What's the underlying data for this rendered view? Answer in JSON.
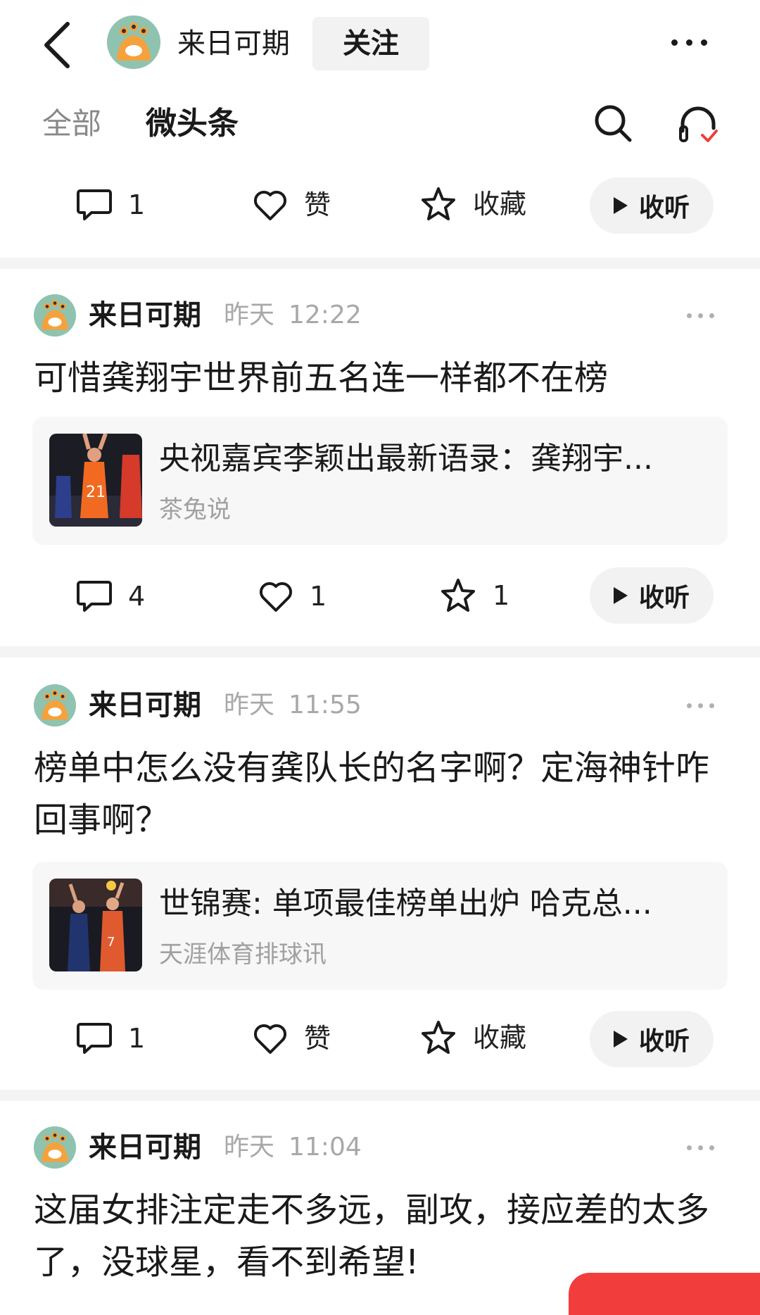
{
  "header": {
    "name": "来日可期",
    "follow_label": "关注"
  },
  "tabs": {
    "all": "全部",
    "micro": "微头条"
  },
  "top_actions": {
    "comment": "1",
    "like": "赞",
    "favorite": "收藏",
    "listen": "收听"
  },
  "posts": [
    {
      "author": "来日可期",
      "date": "昨天",
      "time": "12:22",
      "text": "可惜龚翔宇世界前五名连一样都不在榜",
      "card_title": "央视嘉宾李颖出最新语录：龚翔宇...",
      "card_source": "茶兔说",
      "comment": "4",
      "like": "1",
      "favorite": "1",
      "listen": "收听"
    },
    {
      "author": "来日可期",
      "date": "昨天",
      "time": "11:55",
      "text": "榜单中怎么没有龚队长的名字啊？定海神针咋回事啊？",
      "card_title": "世锦赛: 单项最佳榜单出炉 哈克总...",
      "card_source": "天涯体育排球讯",
      "comment": "1",
      "like": "赞",
      "favorite": "收藏",
      "listen": "收听"
    },
    {
      "author": "来日可期",
      "date": "昨天",
      "time": "11:04",
      "text": "这届女排注定走不多远，副攻，接应差的太多了，没球星，看不到希望!"
    }
  ],
  "colors": {
    "accent_red": "#f23d3d",
    "avatar_bg": "#8fc3b0",
    "muted": "#a8a8a8"
  }
}
